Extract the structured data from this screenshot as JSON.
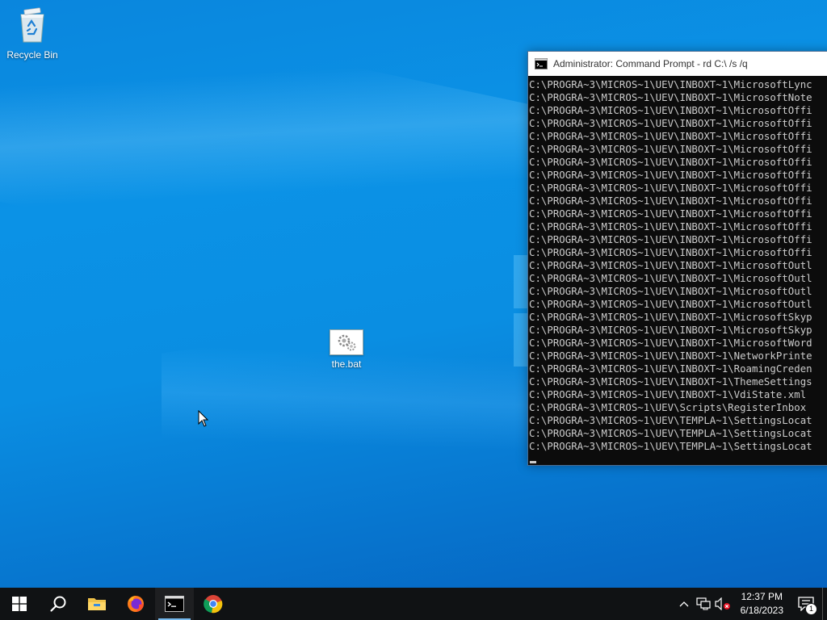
{
  "desktop": {
    "icons": [
      {
        "label": "Recycle Bin",
        "icon": "recycle-bin-icon"
      },
      {
        "label": "the.bat",
        "icon": "batch-file-icon"
      }
    ]
  },
  "console": {
    "title": "Administrator:  Command Prompt - rd  C:\\ /s /q",
    "lines": [
      "C:\\PROGRA~3\\MICROS~1\\UEV\\INBOXT~1\\MicrosoftLync",
      "C:\\PROGRA~3\\MICROS~1\\UEV\\INBOXT~1\\MicrosoftNote",
      "C:\\PROGRA~3\\MICROS~1\\UEV\\INBOXT~1\\MicrosoftOffi",
      "C:\\PROGRA~3\\MICROS~1\\UEV\\INBOXT~1\\MicrosoftOffi",
      "C:\\PROGRA~3\\MICROS~1\\UEV\\INBOXT~1\\MicrosoftOffi",
      "C:\\PROGRA~3\\MICROS~1\\UEV\\INBOXT~1\\MicrosoftOffi",
      "C:\\PROGRA~3\\MICROS~1\\UEV\\INBOXT~1\\MicrosoftOffi",
      "C:\\PROGRA~3\\MICROS~1\\UEV\\INBOXT~1\\MicrosoftOffi",
      "C:\\PROGRA~3\\MICROS~1\\UEV\\INBOXT~1\\MicrosoftOffi",
      "C:\\PROGRA~3\\MICROS~1\\UEV\\INBOXT~1\\MicrosoftOffi",
      "C:\\PROGRA~3\\MICROS~1\\UEV\\INBOXT~1\\MicrosoftOffi",
      "C:\\PROGRA~3\\MICROS~1\\UEV\\INBOXT~1\\MicrosoftOffi",
      "C:\\PROGRA~3\\MICROS~1\\UEV\\INBOXT~1\\MicrosoftOffi",
      "C:\\PROGRA~3\\MICROS~1\\UEV\\INBOXT~1\\MicrosoftOffi",
      "C:\\PROGRA~3\\MICROS~1\\UEV\\INBOXT~1\\MicrosoftOutl",
      "C:\\PROGRA~3\\MICROS~1\\UEV\\INBOXT~1\\MicrosoftOutl",
      "C:\\PROGRA~3\\MICROS~1\\UEV\\INBOXT~1\\MicrosoftOutl",
      "C:\\PROGRA~3\\MICROS~1\\UEV\\INBOXT~1\\MicrosoftOutl",
      "C:\\PROGRA~3\\MICROS~1\\UEV\\INBOXT~1\\MicrosoftSkyp",
      "C:\\PROGRA~3\\MICROS~1\\UEV\\INBOXT~1\\MicrosoftSkyp",
      "C:\\PROGRA~3\\MICROS~1\\UEV\\INBOXT~1\\MicrosoftWord",
      "C:\\PROGRA~3\\MICROS~1\\UEV\\INBOXT~1\\NetworkPrinte",
      "C:\\PROGRA~3\\MICROS~1\\UEV\\INBOXT~1\\RoamingCreden",
      "C:\\PROGRA~3\\MICROS~1\\UEV\\INBOXT~1\\ThemeSettings",
      "C:\\PROGRA~3\\MICROS~1\\UEV\\INBOXT~1\\VdiState.xml",
      "C:\\PROGRA~3\\MICROS~1\\UEV\\Scripts\\RegisterInbox",
      "C:\\PROGRA~3\\MICROS~1\\UEV\\TEMPLA~1\\SettingsLocat",
      "C:\\PROGRA~3\\MICROS~1\\UEV\\TEMPLA~1\\SettingsLocat",
      "C:\\PROGRA~3\\MICROS~1\\UEV\\TEMPLA~1\\SettingsLocat"
    ]
  },
  "taskbar": {
    "items": [
      {
        "name": "start",
        "icon": "windows-logo-icon",
        "active": false
      },
      {
        "name": "search",
        "icon": "search-icon",
        "active": false
      },
      {
        "name": "file-explorer",
        "icon": "folder-icon",
        "active": false
      },
      {
        "name": "firefox",
        "icon": "firefox-icon",
        "active": false
      },
      {
        "name": "command-prompt",
        "icon": "terminal-icon",
        "active": true
      },
      {
        "name": "chrome",
        "icon": "chrome-icon",
        "active": false
      }
    ],
    "tray": {
      "time": "12:37 PM",
      "date": "6/18/2023",
      "notification_count": "1"
    }
  },
  "colors": {
    "desktop_blue": "#0a8ee2",
    "console_bg": "#0c0c0c",
    "console_text": "#cccccc",
    "taskbar_bg": "#101214",
    "active_indicator": "#76b9ed"
  }
}
